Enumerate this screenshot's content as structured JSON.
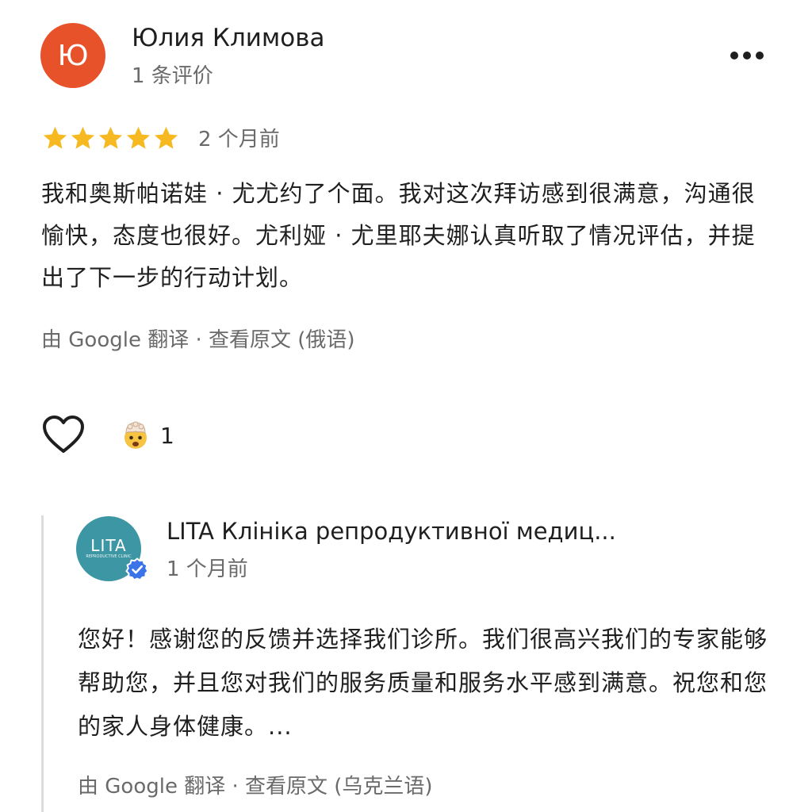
{
  "review": {
    "avatar_letter": "Ю",
    "avatar_color": "#e8522a",
    "reviewer_name": "Юлия Климова",
    "review_count": "1 条评价",
    "more_icon": "more-horizontal-icon",
    "rating": 5,
    "rating_max": 5,
    "star_color": "#f6b921",
    "time": "2 个月前",
    "text": "我和奥斯帕诺娃 · 尤尤约了个面。我对这次拜访感到很满意，沟通很愉快，态度也很好。尤利娅 · 尤里耶夫娜认真听取了情况评估，并提出了下一步的行动计划。",
    "translated_by": "由 Google 翻译 · ",
    "view_original": "查看原文 (俄语)"
  },
  "actions": {
    "like_icon": "heart-outline-icon",
    "reaction_icon": "exploding-head-emoji-icon",
    "reaction_count": "1"
  },
  "owner_reply": {
    "logo_text": "LITA",
    "logo_subtext": "REPRODUCTIVE CLINIC",
    "avatar_color": "#3d96a3",
    "verified_icon": "verified-badge-icon",
    "verified_color": "#3b74e8",
    "name": "LITA Клініка репродуктивної медиц...",
    "time": "1 个月前",
    "text": "您好！感谢您的反馈并选择我们诊所。我们很高兴我们的专家能够帮助您，并且您对我们的服务质量和服务水平感到满意。祝您和您的家人身体健康。...",
    "translated_by": "由 Google 翻译 · ",
    "view_original": "查看原文 (乌克兰语)"
  }
}
